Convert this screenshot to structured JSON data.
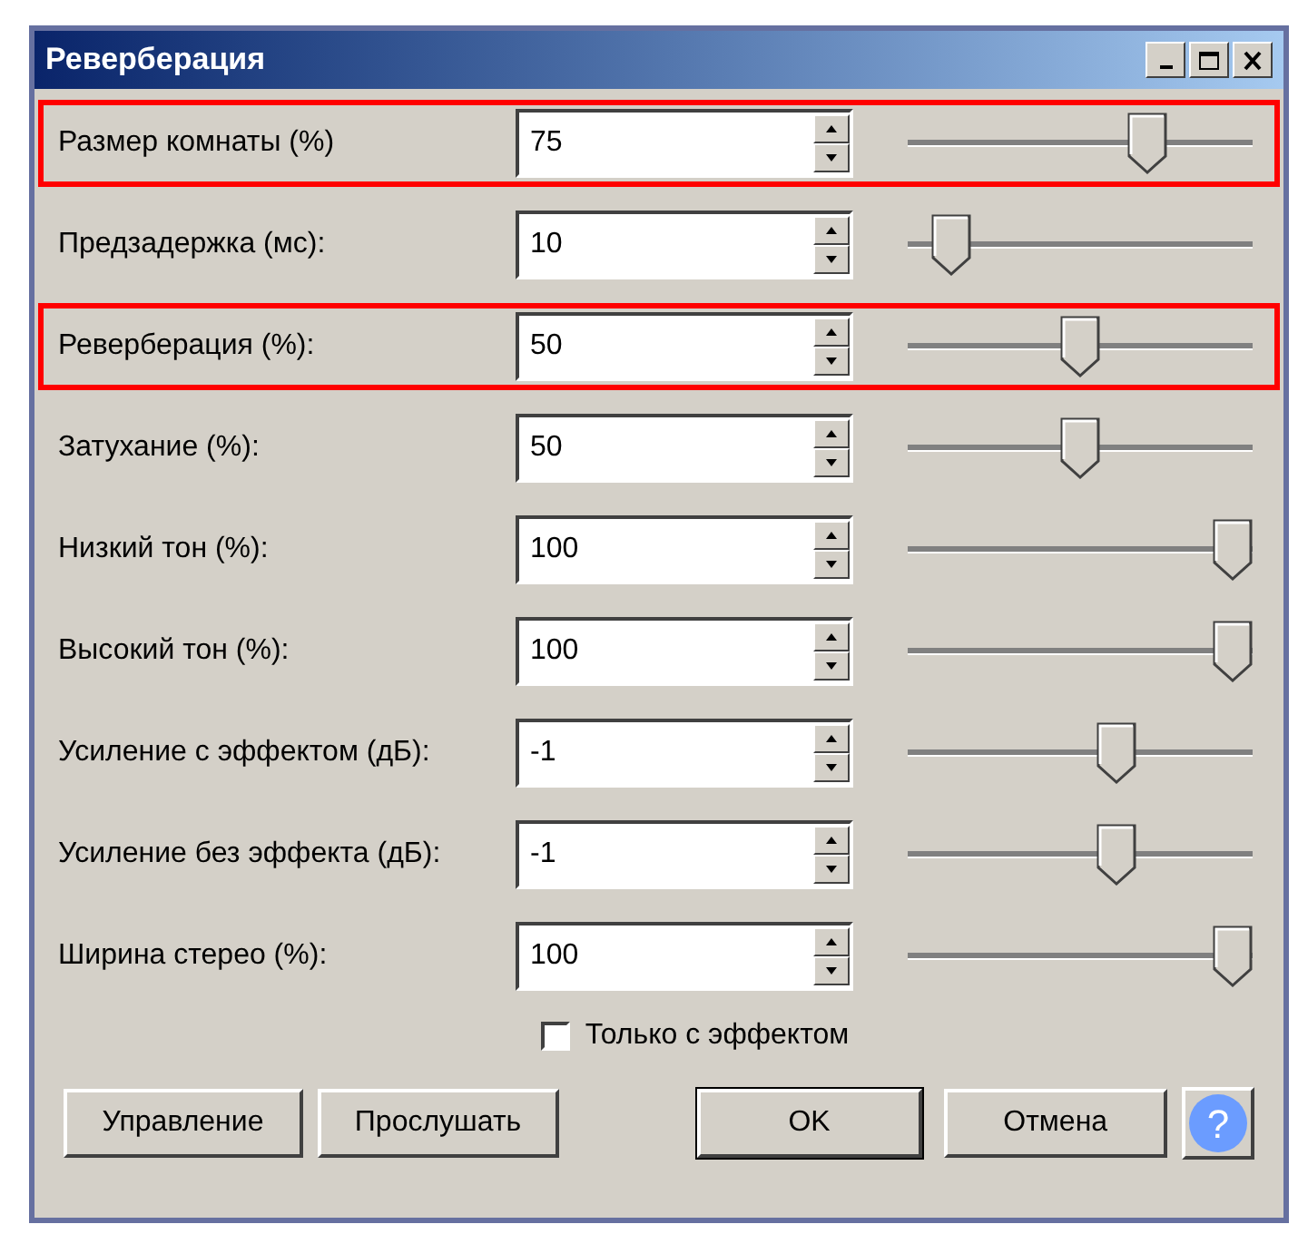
{
  "window": {
    "title": "Реверберация"
  },
  "params": [
    {
      "label": "Размер комнаты (%)",
      "value": "75",
      "level": 0.72,
      "highlighted": true
    },
    {
      "label": "Предзадержка (мс):",
      "value": "10",
      "level": 0.08,
      "highlighted": false
    },
    {
      "label": "Реверберация (%):",
      "value": "50",
      "level": 0.5,
      "highlighted": true
    },
    {
      "label": "Затухание (%):",
      "value": "50",
      "level": 0.5,
      "highlighted": false
    },
    {
      "label": "Низкий тон (%):",
      "value": "100",
      "level": 1,
      "highlighted": false
    },
    {
      "label": "Высокий тон (%):",
      "value": "100",
      "level": 1,
      "highlighted": false
    },
    {
      "label": "Усиление с эффектом (дБ):",
      "value": "-1",
      "level": 0.62,
      "highlighted": false
    },
    {
      "label": "Усиление без эффекта (дБ):",
      "value": "-1",
      "level": 0.62,
      "highlighted": false
    },
    {
      "label": "Ширина стерео (%):",
      "value": "100",
      "level": 1,
      "highlighted": false
    }
  ],
  "wet_only": {
    "label": "Только с эффектом",
    "checked": false
  },
  "buttons": [
    {
      "label": "Управление",
      "default": false
    },
    {
      "label": "Прослушать",
      "default": false
    },
    {
      "label": "OK",
      "default": true
    },
    {
      "label": "Отмена",
      "default": false
    }
  ],
  "help": {
    "label": "?"
  }
}
